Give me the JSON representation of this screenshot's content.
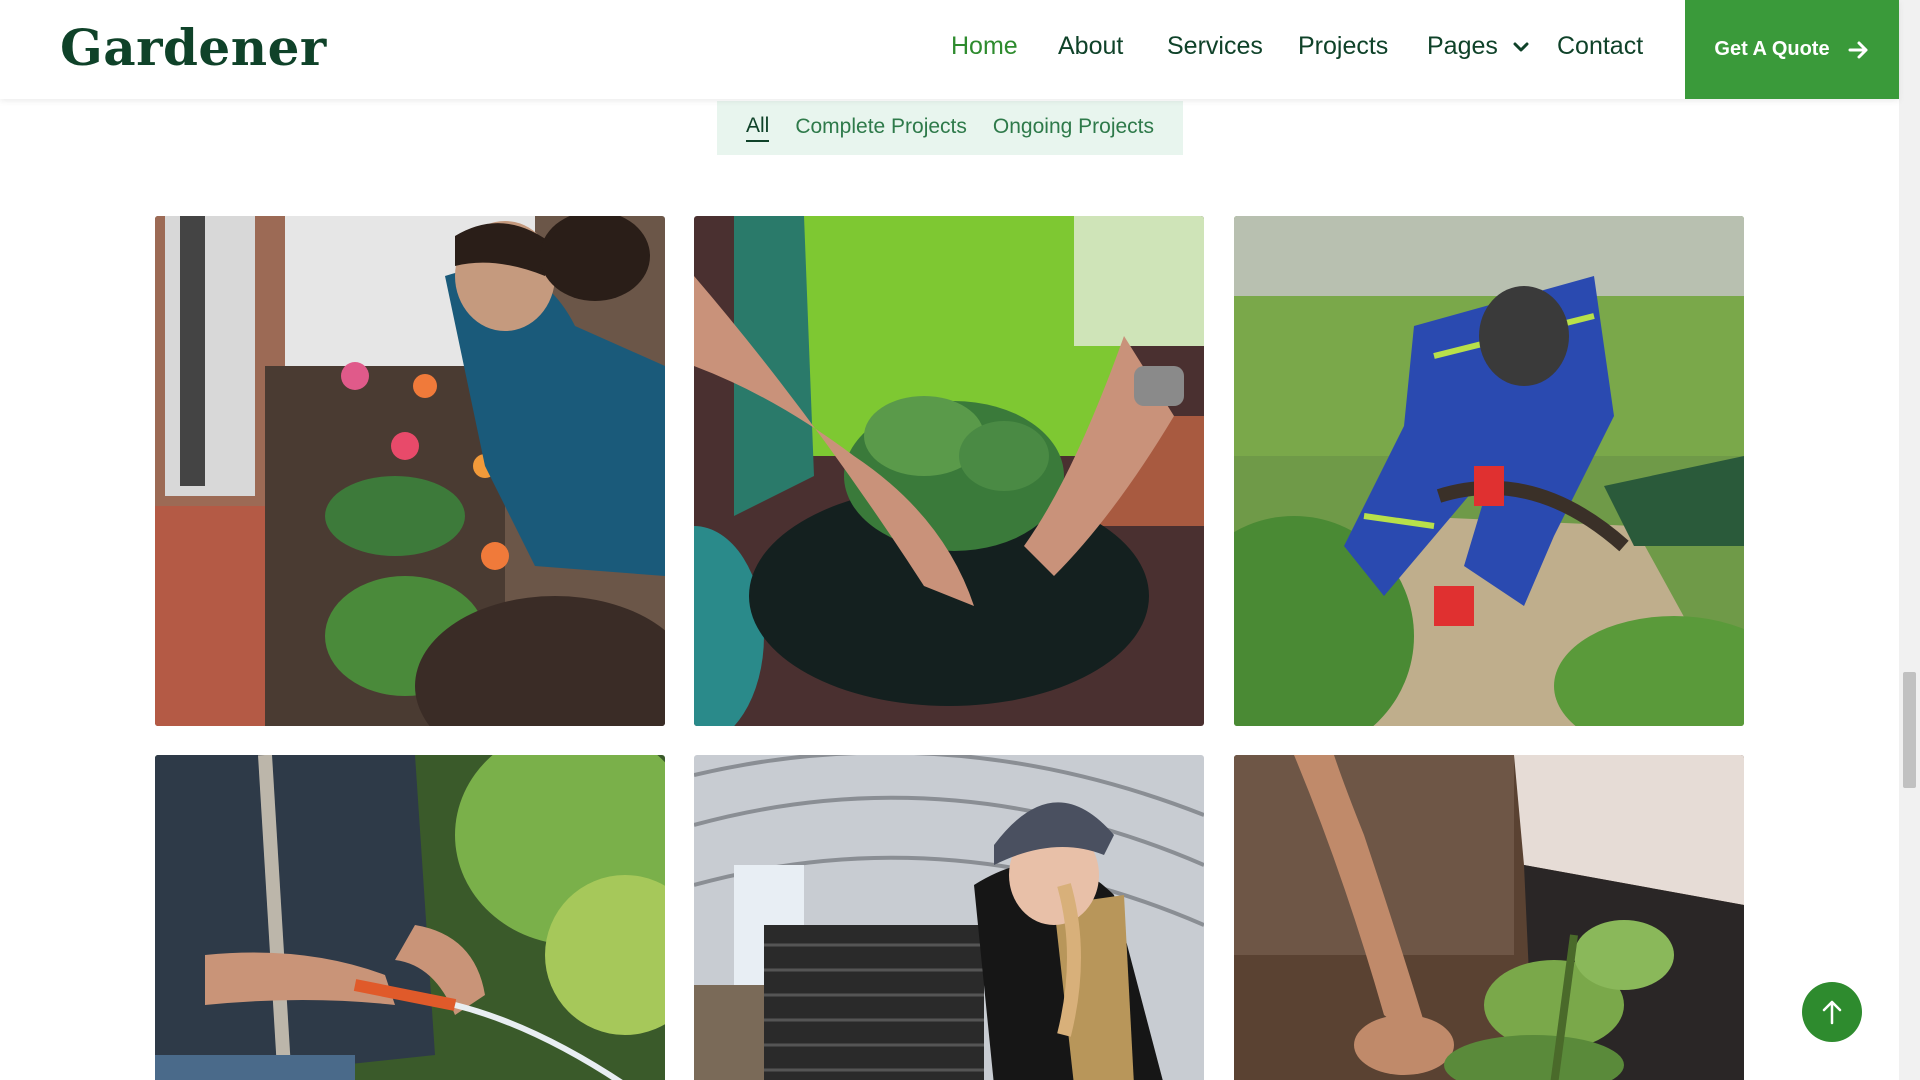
{
  "brand": {
    "logo_text": "Gardener"
  },
  "nav": {
    "items": [
      {
        "label": "Home",
        "active": true
      },
      {
        "label": "About"
      },
      {
        "label": "Services"
      },
      {
        "label": "Projects"
      },
      {
        "label": "Pages",
        "has_dropdown": true
      },
      {
        "label": "Contact"
      }
    ],
    "quote_button": "Get A Quote"
  },
  "filters": {
    "items": [
      {
        "label": "All",
        "active": true
      },
      {
        "label": "Complete Projects"
      },
      {
        "label": "Ongoing Projects"
      }
    ]
  },
  "gallery": {
    "items": [
      {
        "name": "planting-flowers-photo"
      },
      {
        "name": "potting-succulents-photo"
      },
      {
        "name": "field-worker-digging-photo"
      },
      {
        "name": "watering-hose-photo"
      },
      {
        "name": "greenhouse-seedlings-photo"
      },
      {
        "name": "tending-plant-photo"
      }
    ]
  },
  "colors": {
    "brand_dark": "#0f4229",
    "accent_green": "#3a9a3a",
    "active_nav": "#2e8b2e",
    "filter_bg": "#e8f5ee"
  },
  "icons": {
    "quote_button": "arrow-right-icon",
    "pages_dropdown": "chevron-down-icon",
    "back_to_top": "arrow-up-icon"
  }
}
